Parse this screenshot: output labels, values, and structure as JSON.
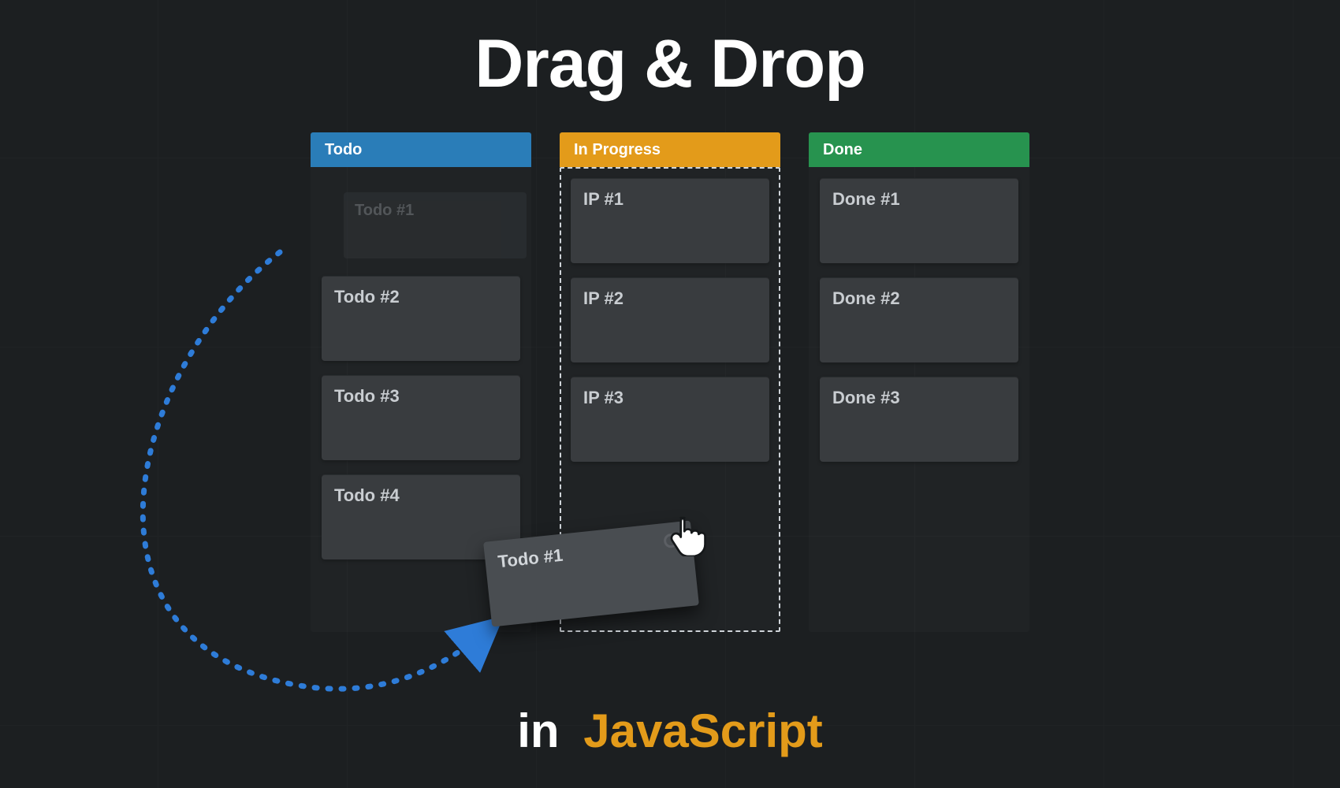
{
  "title": "Drag & Drop",
  "subtitle": {
    "prefix": "in",
    "tech": "JavaScript"
  },
  "colors": {
    "todo": "#2a7db8",
    "in_progress": "#e39b1a",
    "done": "#27934f",
    "path": "#2e7cd8",
    "bg": "#1c1f21"
  },
  "columns": {
    "todo": {
      "label": "Todo",
      "ghost_card": "Todo #1",
      "cards": [
        "Todo #2",
        "Todo #3",
        "Todo #4"
      ]
    },
    "in_progress": {
      "label": "In Progress",
      "cards": [
        "IP #1",
        "IP #2",
        "IP #3"
      ]
    },
    "done": {
      "label": "Done",
      "cards": [
        "Done #1",
        "Done #2",
        "Done #3"
      ]
    }
  },
  "dragging_card": "Todo #1",
  "cursor_icon": "hand-pointer-icon"
}
